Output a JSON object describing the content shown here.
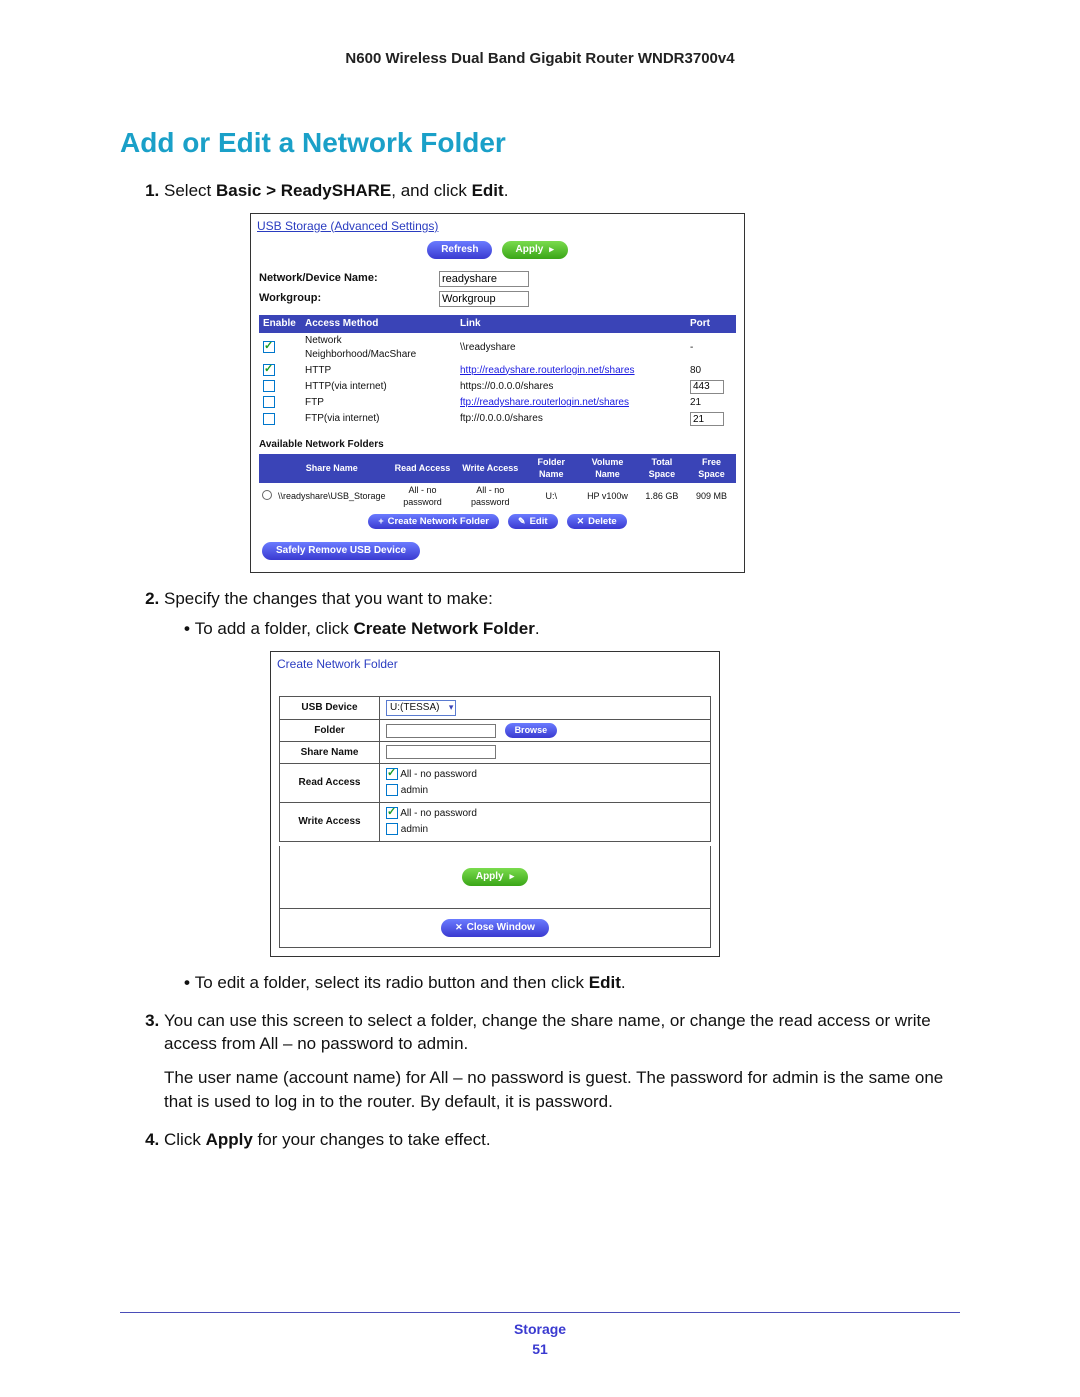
{
  "doc": {
    "title": "N600 Wireless Dual Band Gigabit Router WNDR3700v4",
    "section_heading": "Add or Edit a Network Folder",
    "footer_category": "Storage",
    "page_number": "51"
  },
  "steps": {
    "s1_pre": "Select ",
    "s1_bold": "Basic > ReadySHARE",
    "s1_mid": ", and click ",
    "s1_bold2": "Edit",
    "s1_post": ".",
    "s2": "Specify the changes that you want to make:",
    "s2b1_pre": "To add a folder, click ",
    "s2b1_bold": "Create Network Folder",
    "s2b1_post": ".",
    "s2b2_pre": "To edit a folder, select its radio button and then click ",
    "s2b2_bold": "Edit",
    "s2b2_post": ".",
    "s3a": "You can use this screen to select a folder, change the share name, or change the read access or write access from All – no password to admin.",
    "s3b": "The user name (account name) for All – no password is guest. The password for admin is the same one that is used to log in to the router. By default, it is password.",
    "s4_pre": "Click ",
    "s4_bold": "Apply",
    "s4_post": " for your changes to take effect."
  },
  "shot1": {
    "title": "USB Storage (Advanced Settings)",
    "refresh": "Refresh",
    "apply": "Apply",
    "ndn_label": "Network/Device Name:",
    "ndn_value": "readyshare",
    "wg_label": "Workgroup:",
    "wg_value": "Workgroup",
    "cols": {
      "enable": "Enable",
      "method": "Access Method",
      "link": "Link",
      "port": "Port"
    },
    "rows": [
      {
        "checked": true,
        "method": "Network Neighborhood/MacShare",
        "link": "\\\\readyshare",
        "is_link": false,
        "port": "-"
      },
      {
        "checked": true,
        "method": "HTTP",
        "link": "http://readyshare.routerlogin.net/shares",
        "is_link": true,
        "port": "80"
      },
      {
        "checked": false,
        "method": "HTTP(via internet)",
        "link": "https://0.0.0.0/shares",
        "is_link": false,
        "port": "443"
      },
      {
        "checked": false,
        "method": "FTP",
        "link": "ftp://readyshare.routerlogin.net/shares",
        "is_link": true,
        "port": "21"
      },
      {
        "checked": false,
        "method": "FTP(via internet)",
        "link": "ftp://0.0.0.0/shares",
        "is_link": false,
        "port": "21"
      }
    ],
    "avail_label": "Available Network Folders",
    "fcols": {
      "sel": "",
      "share": "Share Name",
      "read": "Read Access",
      "write": "Write Access",
      "folder": "Folder Name",
      "vol": "Volume Name",
      "total": "Total Space",
      "free": "Free Space"
    },
    "frow": {
      "share": "\\\\readyshare\\USB_Storage",
      "read": "All - no password",
      "write": "All - no password",
      "folder": "U:\\",
      "vol": "HP v100w",
      "total": "1.86 GB",
      "free": "909 MB"
    },
    "btn_create": "Create Network Folder",
    "btn_edit": "Edit",
    "btn_delete": "Delete",
    "btn_safe": "Safely Remove USB Device"
  },
  "shot2": {
    "title": "Create Network Folder",
    "usb_label": "USB Device",
    "usb_value": "U:(TESSA)",
    "folder_label": "Folder",
    "folder_value": "",
    "browse": "Browse",
    "share_label": "Share Name",
    "share_value": "",
    "read_label": "Read Access",
    "write_label": "Write Access",
    "all_np": "All - no password",
    "admin": "admin",
    "apply": "Apply",
    "close": "Close Window"
  }
}
